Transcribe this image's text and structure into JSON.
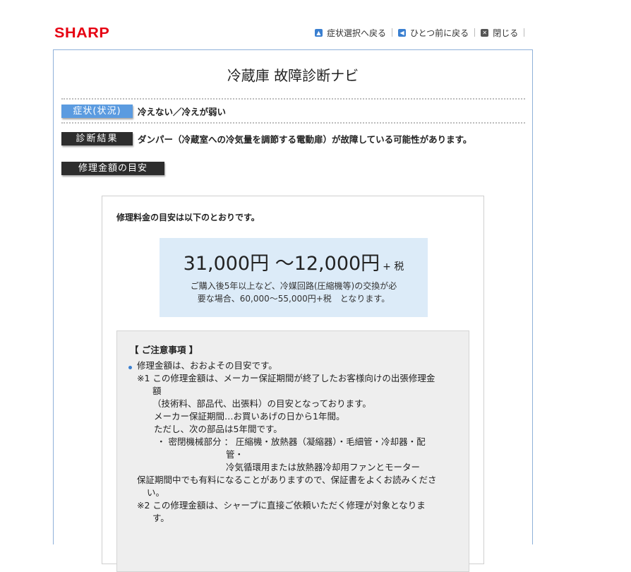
{
  "brand": {
    "logo": "SHARP",
    "logo_color": "#e60012"
  },
  "topnav": [
    {
      "label": "症状選択へ戻る",
      "icon": "arrow-up-icon"
    },
    {
      "label": "ひとつ前に戻る",
      "icon": "arrow-left-icon"
    },
    {
      "label": "閉じる",
      "icon": "close-icon"
    }
  ],
  "page": {
    "title": "冷蔵庫 故障診断ナビ"
  },
  "symptom": {
    "label": "症状(状況)",
    "text": "冷えない／冷えが弱い"
  },
  "diagnosis": {
    "label": "診断結果",
    "text": "ダンパー（冷蔵室への冷気量を調節する電動扉）が故障している可能性があります。"
  },
  "repair": {
    "label": "修理金額の目安",
    "intro": "修理料金の目安は以下のとおりです。",
    "price": "31,000円 ～12,000円",
    "tax": "+ 税",
    "note": [
      "ご購入後5年以上など、冷媒回路(圧縮機等)の交換が必",
      "要な場合、60,000～55,000円+税　となります。"
    ]
  },
  "notes": {
    "heading": "【 ご注意事項 】",
    "lines": [
      "修理金額は、おおよその目安です。",
      "※1 この修理金額は、メーカー保証期間が終了したお客様向けの出張修理金",
      "額",
      "（技術料、部品代、出張料）の目安となっております。",
      "メーカー保証期間…お買いあげの日から1年間。",
      "ただし、次の部品は5年間です。",
      "・ 密閉機械部分 ： 圧縮機・放熱器（凝縮器）・毛細管・冷却器・配",
      "管・",
      "冷気循環用または放熱器冷却用ファンとモーター",
      "保証期間中でも有料になることがありますので、保証書をよくお読みくださ",
      "い。",
      "※2 この修理金額は、シャープに直接ご依頼いただく修理が対象となりま",
      "す。"
    ]
  },
  "colors": {
    "accent_blue": "#5b9be0",
    "tag_dark": "#2d2d2d",
    "price_bg": "#dcebf8",
    "frame_border": "#8fb0d9",
    "notes_bg": "#eeeeee"
  }
}
